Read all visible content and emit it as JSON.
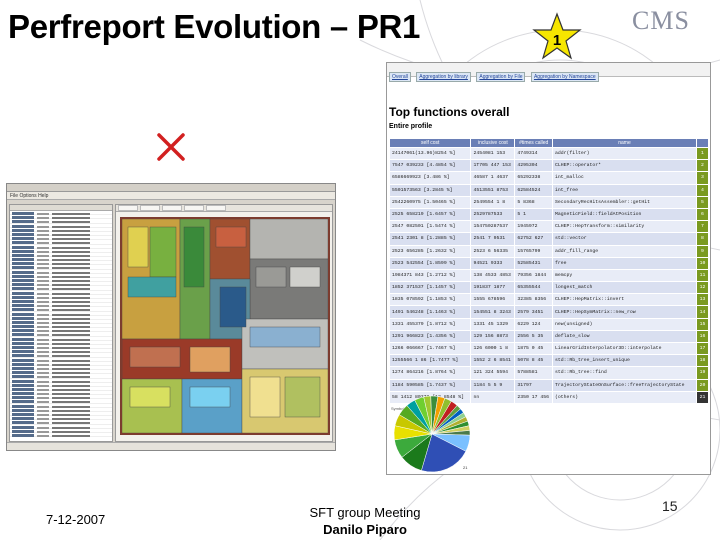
{
  "slide": {
    "title": "Perfreport Evolution – PR1",
    "star_number": "1",
    "logo": "CMS",
    "date": "7-12-2007",
    "footer_line1": "SFT group Meeting",
    "footer_line2": "Danilo Piparo",
    "page_number": "15"
  },
  "old_tool": {
    "menu": "File  Options  Help"
  },
  "report": {
    "tabs": [
      "Overall",
      "Aggregation by library",
      "Aggregation by File",
      "Aggregation by Namespace"
    ],
    "heading": "Top functions overall",
    "subheading": "Entire profile",
    "columns": [
      "self cost",
      "inclusive cost",
      "#times called",
      "name"
    ],
    "rows": [
      {
        "self": "24147061(13.96)8254 %]",
        "incl": "2454081 153",
        "calls": "4749314",
        "name": "addr(filter)",
        "rank": "1"
      },
      {
        "self": "7547 039233 [4.4854 %]",
        "incl": "1T705 447 153",
        "calls": "4295304",
        "name": "CLHEP::operator*",
        "rank": "2"
      },
      {
        "self": "6586669923 [3.486 %]",
        "incl": "46587 1 4637",
        "calls": "65292338",
        "name": "int_malloc",
        "rank": "3"
      },
      {
        "self": "5501573563 [3.2845 %]",
        "incl": "4513551 8753",
        "calls": "62584524",
        "name": "int_free",
        "rank": "4"
      },
      {
        "self": "2542260975 [1.50465 %]",
        "incl": "2549554 1 8",
        "calls": "5 8368",
        "name": "SecondaryRecHitsAssembler::getHit",
        "rank": "5"
      },
      {
        "self": "2525 658219 [1.6457 %]",
        "incl": "2529787533",
        "calls": "5 1",
        "name": "MagneticField::fieldAtPosition",
        "rank": "6"
      },
      {
        "self": "2547 082501 [1.5474 %]",
        "incl": "154750287537",
        "calls": "1945972",
        "name": "CLHEP::HepTransform::similarity",
        "rank": "7"
      },
      {
        "self": "2541 2301 8 [1.2885 %]",
        "incl": "2541 7 9531",
        "calls": "62752 627",
        "name": "std::vector",
        "rank": "8"
      },
      {
        "self": "2523 656285 [1.2632 %]",
        "incl": "2523 6 56335",
        "calls": "15765799",
        "name": "addr_fill_range",
        "rank": "9"
      },
      {
        "self": "2523 542554 [1.8599 %]",
        "incl": "94521 9333",
        "calls": "52585431",
        "name": "free",
        "rank": "10"
      },
      {
        "self": "1984371 843 [1.2712 %]",
        "incl": "138 4533 4853",
        "calls": "79356 1844",
        "name": "memcpy",
        "rank": "11"
      },
      {
        "self": "1852 371537 [1.1457 %]",
        "incl": "191837 1877",
        "calls": "65355544",
        "name": "longest_match",
        "rank": "12"
      },
      {
        "self": "1835 078592 [1.1853 %]",
        "incl": "1555 678596",
        "calls": "32385 8356",
        "name": "CLHEP::HepMatrix::invert",
        "rank": "13"
      },
      {
        "self": "1491 546248 [1.1463 %]",
        "incl": "154551 8 3243",
        "calls": "2579 3451",
        "name": "CLHEP::HepSymMatrix::new_row",
        "rank": "14"
      },
      {
        "self": "1331 455379 [1.8712 %]",
        "incl": "1331 45 1329",
        "calls": "6229 124",
        "name": "new(unsigned)",
        "rank": "15"
      },
      {
        "self": "1291 966823 [1.4356 %]",
        "incl": "129 156 8873",
        "calls": "2556 5 35",
        "name": "deflate_slow",
        "rank": "16"
      },
      {
        "self": "1266 066667 [1.7467 %]",
        "incl": "126 6000 1 8",
        "calls": "1875 0 45",
        "name": "LinearGridInterpolator3D::interpolate",
        "rank": "17"
      },
      {
        "self": "1255566 1 86 [1.7477 %]",
        "incl": "1552 2 6 8541",
        "calls": "5078 8 45",
        "name": "std::Rb_tree_insert_unique",
        "rank": "18"
      },
      {
        "self": "1274 864216 [1.8764 %]",
        "incl": "121 324 5594",
        "calls": "5788581",
        "name": "std::Rb_tree::find",
        "rank": "19"
      },
      {
        "self": "1184 590585 [1.7437 %]",
        "incl": "1184 5 5 9",
        "calls": "31797",
        "name": "TrajectoryStateOnSurface::freeTrajectoryState",
        "rank": "20"
      },
      {
        "self": "58 1412 80372 [12.8548 %]",
        "incl": "nn",
        "calls": "2350 17 456",
        "name": "(others)",
        "rank": "21"
      }
    ],
    "pie_note": "Symbol distribution",
    "slice_label": "21"
  },
  "pie_data": {
    "values": [
      22,
      10,
      8,
      6,
      5,
      5,
      4,
      4,
      3,
      3,
      3,
      3,
      3,
      2,
      2,
      2,
      2,
      2,
      2,
      2,
      7
    ],
    "colors": [
      "#2f4fb5",
      "#1b7a1b",
      "#3caa3c",
      "#e8e000",
      "#c8c800",
      "#55aa22",
      "#00a0a0",
      "#6fcf30",
      "#a0c830",
      "#3b8d3b",
      "#f0a000",
      "#8fbf2f",
      "#c02020",
      "#5f9f3f",
      "#0060c0",
      "#90d090",
      "#b0b030",
      "#2f8f2f",
      "#d0d060",
      "#4a7a4a",
      "#7ac0ff"
    ]
  }
}
